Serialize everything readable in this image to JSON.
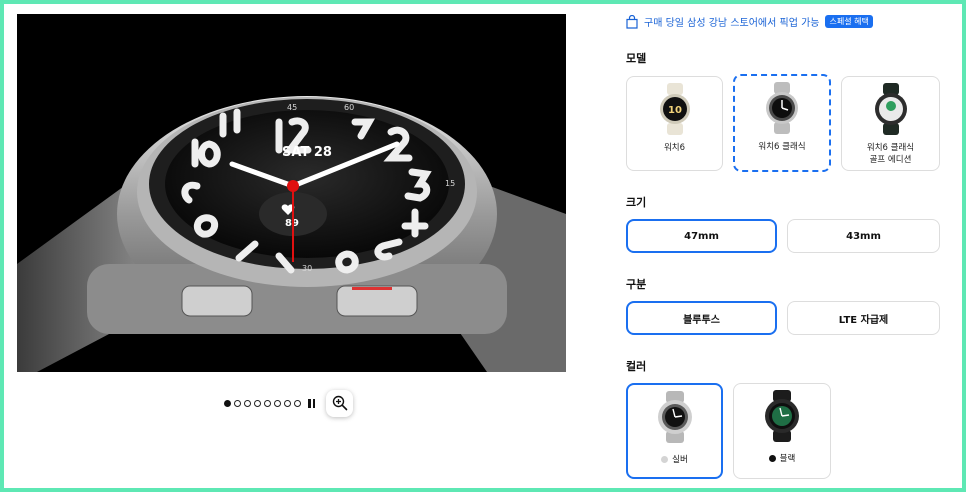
{
  "pickup": {
    "text": "구매 당일 삼성 강남 스토어에서 픽업 가능",
    "badge": "스페셜 혜택"
  },
  "hero": {
    "watch_date": "SAT 28",
    "heart_rate": "89",
    "bezel_numbers": [
      "45",
      "15",
      "30",
      "60"
    ]
  },
  "carousel": {
    "slide_count": 8,
    "active_index": 0
  },
  "model": {
    "title": "모델",
    "options": [
      {
        "label": "워치6",
        "selected": false
      },
      {
        "label": "워치6 클래식",
        "selected": true
      },
      {
        "label_line1": "워치6 클래식",
        "label_line2": "골프 에디션",
        "selected": false
      }
    ]
  },
  "size": {
    "title": "크기",
    "options": [
      "47mm",
      "43mm"
    ],
    "selected_index": 0
  },
  "type": {
    "title": "구분",
    "options": [
      "블루투스",
      "LTE 자급제"
    ],
    "selected_index": 0
  },
  "color": {
    "title": "컬러",
    "options": [
      {
        "label": "실버",
        "swatch": "#d4d4d4"
      },
      {
        "label": "블랙",
        "swatch": "#111111"
      }
    ],
    "selected_index": 0
  },
  "colors": {
    "accent": "#1a6ff0",
    "frame": "#5ee8b4",
    "pickup_text": "#1a63d6"
  }
}
